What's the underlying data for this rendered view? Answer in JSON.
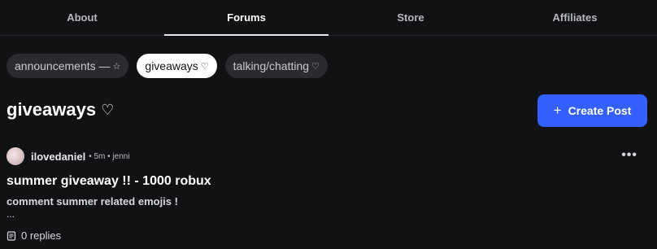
{
  "tabs": [
    "About",
    "Forums",
    "Store",
    "Affiliates"
  ],
  "active_tab": "Forums",
  "chips": [
    {
      "label": "announcements —",
      "symbol": "☆",
      "active": false
    },
    {
      "label": "giveaways",
      "symbol": "♡",
      "active": true
    },
    {
      "label": "talking/chatting",
      "symbol": "♡",
      "active": false
    }
  ],
  "page": {
    "title": "giveaways",
    "title_symbol": "♡"
  },
  "create_button": {
    "label": "Create Post"
  },
  "post": {
    "author": "ilovedaniel",
    "meta": "• 5m • jenni",
    "title": "summer giveaway !! - 1000 robux",
    "body": "comment summer related emojis !",
    "ellipsis": "...",
    "replies": "0 replies",
    "more_icon": "ellipsis-icon"
  },
  "colors": {
    "background": "#111214",
    "accent": "#335fff",
    "chip": "#2a2b2f"
  }
}
